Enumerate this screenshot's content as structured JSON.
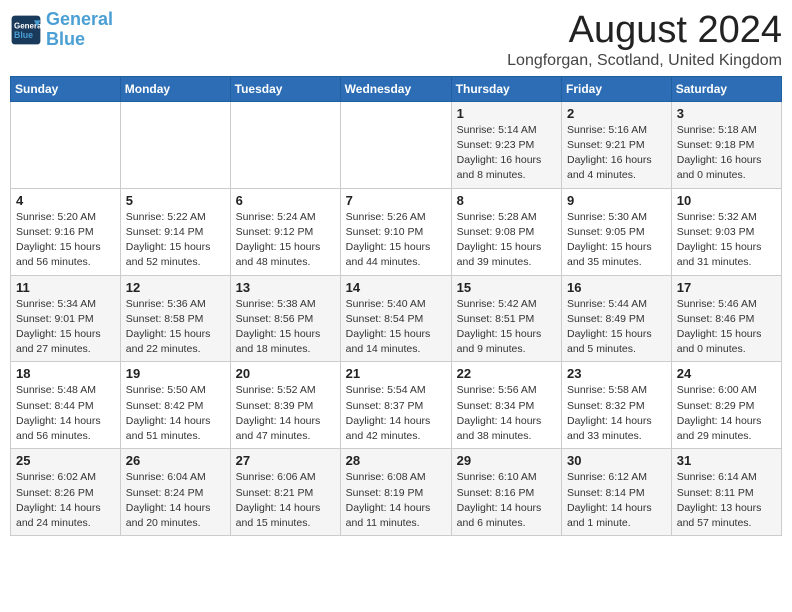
{
  "header": {
    "logo_line1": "General",
    "logo_line2": "Blue",
    "main_title": "August 2024",
    "subtitle": "Longforgan, Scotland, United Kingdom"
  },
  "calendar": {
    "days_of_week": [
      "Sunday",
      "Monday",
      "Tuesday",
      "Wednesday",
      "Thursday",
      "Friday",
      "Saturday"
    ],
    "weeks": [
      [
        {
          "day": "",
          "info": ""
        },
        {
          "day": "",
          "info": ""
        },
        {
          "day": "",
          "info": ""
        },
        {
          "day": "",
          "info": ""
        },
        {
          "day": "1",
          "info": "Sunrise: 5:14 AM\nSunset: 9:23 PM\nDaylight: 16 hours\nand 8 minutes."
        },
        {
          "day": "2",
          "info": "Sunrise: 5:16 AM\nSunset: 9:21 PM\nDaylight: 16 hours\nand 4 minutes."
        },
        {
          "day": "3",
          "info": "Sunrise: 5:18 AM\nSunset: 9:18 PM\nDaylight: 16 hours\nand 0 minutes."
        }
      ],
      [
        {
          "day": "4",
          "info": "Sunrise: 5:20 AM\nSunset: 9:16 PM\nDaylight: 15 hours\nand 56 minutes."
        },
        {
          "day": "5",
          "info": "Sunrise: 5:22 AM\nSunset: 9:14 PM\nDaylight: 15 hours\nand 52 minutes."
        },
        {
          "day": "6",
          "info": "Sunrise: 5:24 AM\nSunset: 9:12 PM\nDaylight: 15 hours\nand 48 minutes."
        },
        {
          "day": "7",
          "info": "Sunrise: 5:26 AM\nSunset: 9:10 PM\nDaylight: 15 hours\nand 44 minutes."
        },
        {
          "day": "8",
          "info": "Sunrise: 5:28 AM\nSunset: 9:08 PM\nDaylight: 15 hours\nand 39 minutes."
        },
        {
          "day": "9",
          "info": "Sunrise: 5:30 AM\nSunset: 9:05 PM\nDaylight: 15 hours\nand 35 minutes."
        },
        {
          "day": "10",
          "info": "Sunrise: 5:32 AM\nSunset: 9:03 PM\nDaylight: 15 hours\nand 31 minutes."
        }
      ],
      [
        {
          "day": "11",
          "info": "Sunrise: 5:34 AM\nSunset: 9:01 PM\nDaylight: 15 hours\nand 27 minutes."
        },
        {
          "day": "12",
          "info": "Sunrise: 5:36 AM\nSunset: 8:58 PM\nDaylight: 15 hours\nand 22 minutes."
        },
        {
          "day": "13",
          "info": "Sunrise: 5:38 AM\nSunset: 8:56 PM\nDaylight: 15 hours\nand 18 minutes."
        },
        {
          "day": "14",
          "info": "Sunrise: 5:40 AM\nSunset: 8:54 PM\nDaylight: 15 hours\nand 14 minutes."
        },
        {
          "day": "15",
          "info": "Sunrise: 5:42 AM\nSunset: 8:51 PM\nDaylight: 15 hours\nand 9 minutes."
        },
        {
          "day": "16",
          "info": "Sunrise: 5:44 AM\nSunset: 8:49 PM\nDaylight: 15 hours\nand 5 minutes."
        },
        {
          "day": "17",
          "info": "Sunrise: 5:46 AM\nSunset: 8:46 PM\nDaylight: 15 hours\nand 0 minutes."
        }
      ],
      [
        {
          "day": "18",
          "info": "Sunrise: 5:48 AM\nSunset: 8:44 PM\nDaylight: 14 hours\nand 56 minutes."
        },
        {
          "day": "19",
          "info": "Sunrise: 5:50 AM\nSunset: 8:42 PM\nDaylight: 14 hours\nand 51 minutes."
        },
        {
          "day": "20",
          "info": "Sunrise: 5:52 AM\nSunset: 8:39 PM\nDaylight: 14 hours\nand 47 minutes."
        },
        {
          "day": "21",
          "info": "Sunrise: 5:54 AM\nSunset: 8:37 PM\nDaylight: 14 hours\nand 42 minutes."
        },
        {
          "day": "22",
          "info": "Sunrise: 5:56 AM\nSunset: 8:34 PM\nDaylight: 14 hours\nand 38 minutes."
        },
        {
          "day": "23",
          "info": "Sunrise: 5:58 AM\nSunset: 8:32 PM\nDaylight: 14 hours\nand 33 minutes."
        },
        {
          "day": "24",
          "info": "Sunrise: 6:00 AM\nSunset: 8:29 PM\nDaylight: 14 hours\nand 29 minutes."
        }
      ],
      [
        {
          "day": "25",
          "info": "Sunrise: 6:02 AM\nSunset: 8:26 PM\nDaylight: 14 hours\nand 24 minutes."
        },
        {
          "day": "26",
          "info": "Sunrise: 6:04 AM\nSunset: 8:24 PM\nDaylight: 14 hours\nand 20 minutes."
        },
        {
          "day": "27",
          "info": "Sunrise: 6:06 AM\nSunset: 8:21 PM\nDaylight: 14 hours\nand 15 minutes."
        },
        {
          "day": "28",
          "info": "Sunrise: 6:08 AM\nSunset: 8:19 PM\nDaylight: 14 hours\nand 11 minutes."
        },
        {
          "day": "29",
          "info": "Sunrise: 6:10 AM\nSunset: 8:16 PM\nDaylight: 14 hours\nand 6 minutes."
        },
        {
          "day": "30",
          "info": "Sunrise: 6:12 AM\nSunset: 8:14 PM\nDaylight: 14 hours\nand 1 minute."
        },
        {
          "day": "31",
          "info": "Sunrise: 6:14 AM\nSunset: 8:11 PM\nDaylight: 13 hours\nand 57 minutes."
        }
      ]
    ]
  }
}
